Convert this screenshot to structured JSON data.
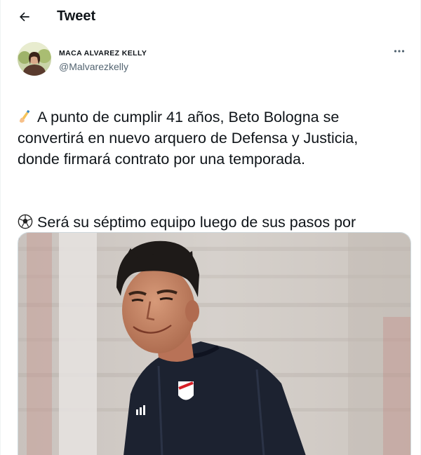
{
  "header": {
    "title": "Tweet"
  },
  "author": {
    "display_name": "MACA ALVAREZ KELLY",
    "handle": "@Malvarezkelly"
  },
  "tweet": {
    "paragraph_1": {
      "emoji": "writing-hand-icon",
      "text": "A punto de cumplir 41 años, Beto Bologna se\nconvertirá en nuevo arquero de Defensa y Justicia,\ndonde firmará contrato por una temporada."
    },
    "paragraph_2": {
      "emoji": "soccer-ball-icon",
      "text": "Será su séptimo equipo luego de sus pasos por\nBanfield (cuatro ciclos), Alianza Lima, Unión, Peñarol,\nGimnasia LP y River Plate."
    }
  },
  "colors": {
    "text_primary": "#0f1419",
    "text_secondary": "#536471",
    "border": "#cfd9de"
  },
  "icons": {
    "back": "back-arrow-icon",
    "more": "more-options-icon"
  }
}
